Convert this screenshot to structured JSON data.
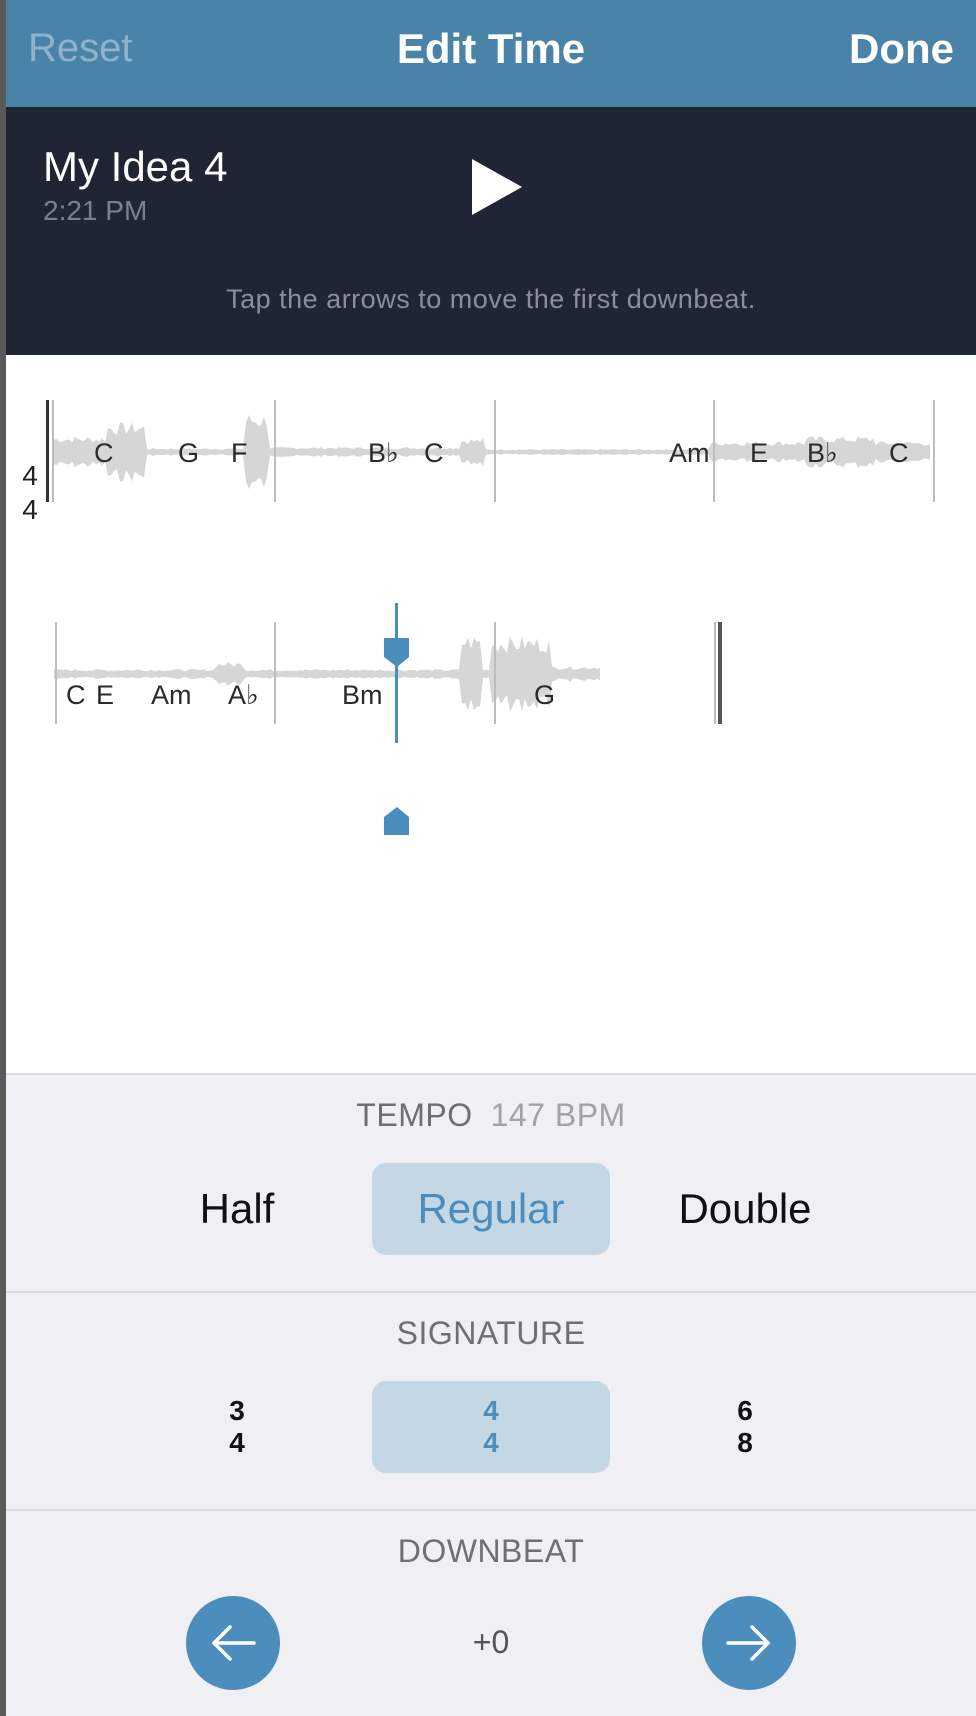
{
  "nav": {
    "reset_label": "Reset",
    "title": "Edit Time",
    "done_label": "Done"
  },
  "recording": {
    "name": "My Idea 4",
    "time": "2:21 PM",
    "play_icon": "play-icon",
    "hint": "Tap the arrows to move the first downbeat."
  },
  "score": {
    "time_signature": {
      "top": "4",
      "bottom": "4"
    },
    "row1_chords": [
      "C",
      "G",
      "F",
      "B♭",
      "C",
      "Am",
      "E",
      "B♭",
      "C"
    ],
    "row2_chords": [
      "C",
      "E",
      "Am",
      "A♭",
      "Bm",
      "G"
    ]
  },
  "tempo": {
    "label": "TEMPO",
    "bpm": "147 BPM",
    "options": [
      "Half",
      "Regular",
      "Double"
    ],
    "selected": "Regular"
  },
  "signature": {
    "label": "SIGNATURE",
    "options": [
      {
        "top": "3",
        "bottom": "4"
      },
      {
        "top": "4",
        "bottom": "4"
      },
      {
        "top": "6",
        "bottom": "8"
      }
    ],
    "selected_index": 1
  },
  "downbeat": {
    "label": "DOWNBEAT",
    "offset": "+0",
    "left_icon": "arrow-left-icon",
    "right_icon": "arrow-right-icon"
  },
  "colors": {
    "accent": "#4b8dbd",
    "nav_bg": "#4983a8",
    "header_bg": "#1f2532",
    "waveform": "#d6d6d6"
  }
}
